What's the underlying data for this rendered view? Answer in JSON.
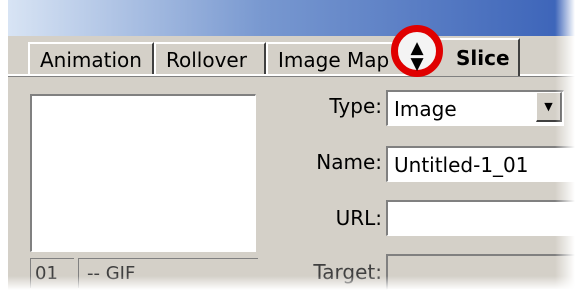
{
  "tabs": {
    "animation": "Animation",
    "rollover": "Rollover",
    "image_map": "Image Map",
    "slice": "Slice"
  },
  "highlight_icon": "up-down-arrows-icon",
  "highlight_color": "#e00000",
  "preview": {
    "number": "01",
    "format": "-- GIF"
  },
  "form": {
    "type_label": "Type:",
    "type_value": "Image",
    "name_label": "Name:",
    "name_value": "Untitled-1_01",
    "url_label": "URL:",
    "url_value": "",
    "target_label": "Target:",
    "target_value": ""
  }
}
